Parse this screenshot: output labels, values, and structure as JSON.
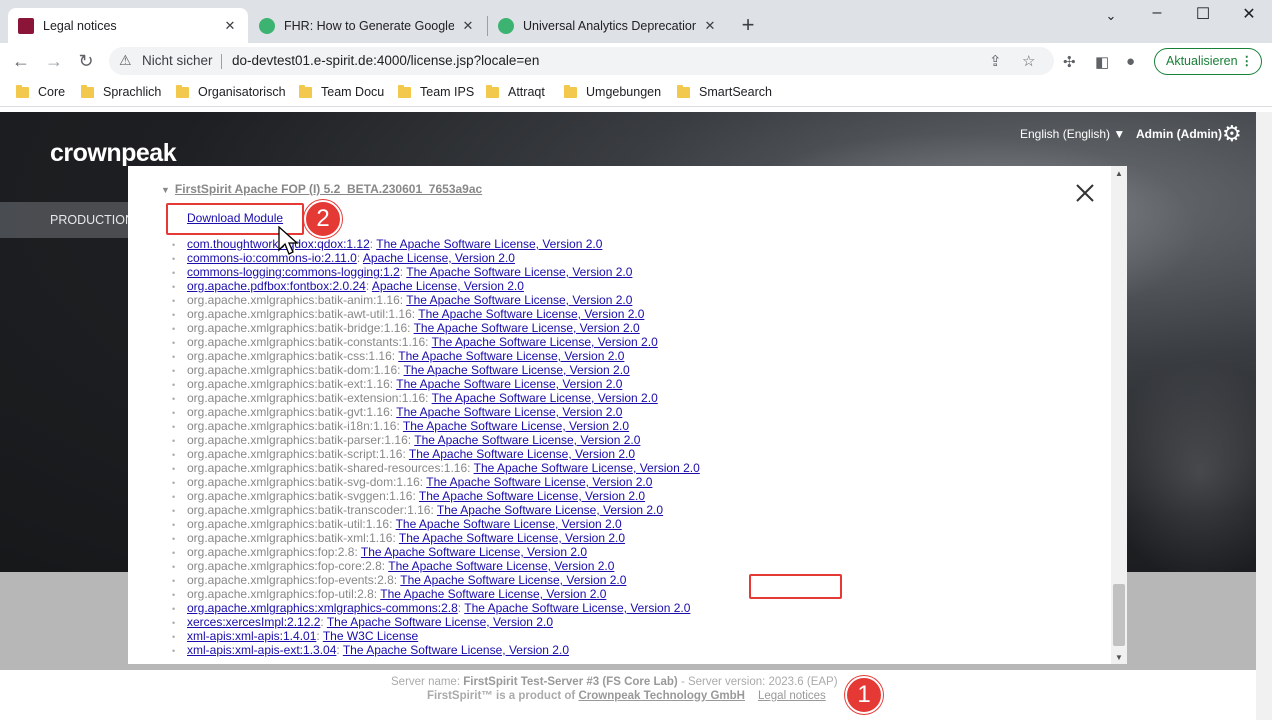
{
  "browser": {
    "tabs": [
      {
        "title": "Legal notices",
        "favicon_color": "#8b1538"
      },
      {
        "title": "FHR: How to Generate Google An",
        "favicon_color": "#3cb371"
      },
      {
        "title": "Universal Analytics Deprecation, l",
        "favicon_color": "#3cb371"
      }
    ],
    "new_tab": "+",
    "not_secure": "Nicht sicher",
    "url": "do-devtest01.e-spirit.de:4000/license.jsp?locale=en",
    "update_label": "Aktualisieren",
    "bookmarks": [
      "Core",
      "Sprachlich",
      "Organisatorisch",
      "Team Docu",
      "Team IPS",
      "Attraqt",
      "Umgebungen",
      "SmartSearch"
    ]
  },
  "header": {
    "logo": "crownpeak",
    "language": "English (English) ▼",
    "user": "Admin (Admin)",
    "nav_item": "PRODUCTION"
  },
  "modal": {
    "module_title": "FirstSpirit Apache FOP (I) 5.2_BETA.230601_7653a9ac",
    "download_label": "Download Module",
    "dependencies": [
      {
        "artifact": "com.thoughtworks.qdox:qdox:1.12",
        "license": "The Apache Software License, Version 2.0",
        "linked": true
      },
      {
        "artifact": "commons-io:commons-io:2.11.0",
        "license": "Apache License, Version 2.0",
        "linked": true
      },
      {
        "artifact": "commons-logging:commons-logging:1.2",
        "license": "The Apache Software License, Version 2.0",
        "linked": true
      },
      {
        "artifact": "org.apache.pdfbox:fontbox:2.0.24",
        "license": "Apache License, Version 2.0",
        "linked": true
      },
      {
        "artifact": "org.apache.xmlgraphics:batik-anim:1.16",
        "license": "The Apache Software License, Version 2.0",
        "linked": false
      },
      {
        "artifact": "org.apache.xmlgraphics:batik-awt-util:1.16",
        "license": "The Apache Software License, Version 2.0",
        "linked": false
      },
      {
        "artifact": "org.apache.xmlgraphics:batik-bridge:1.16",
        "license": "The Apache Software License, Version 2.0",
        "linked": false
      },
      {
        "artifact": "org.apache.xmlgraphics:batik-constants:1.16",
        "license": "The Apache Software License, Version 2.0",
        "linked": false
      },
      {
        "artifact": "org.apache.xmlgraphics:batik-css:1.16",
        "license": "The Apache Software License, Version 2.0",
        "linked": false
      },
      {
        "artifact": "org.apache.xmlgraphics:batik-dom:1.16",
        "license": "The Apache Software License, Version 2.0",
        "linked": false
      },
      {
        "artifact": "org.apache.xmlgraphics:batik-ext:1.16",
        "license": "The Apache Software License, Version 2.0",
        "linked": false
      },
      {
        "artifact": "org.apache.xmlgraphics:batik-extension:1.16",
        "license": "The Apache Software License, Version 2.0",
        "linked": false
      },
      {
        "artifact": "org.apache.xmlgraphics:batik-gvt:1.16",
        "license": "The Apache Software License, Version 2.0",
        "linked": false
      },
      {
        "artifact": "org.apache.xmlgraphics:batik-i18n:1.16",
        "license": "The Apache Software License, Version 2.0",
        "linked": false
      },
      {
        "artifact": "org.apache.xmlgraphics:batik-parser:1.16",
        "license": "The Apache Software License, Version 2.0",
        "linked": false
      },
      {
        "artifact": "org.apache.xmlgraphics:batik-script:1.16",
        "license": "The Apache Software License, Version 2.0",
        "linked": false
      },
      {
        "artifact": "org.apache.xmlgraphics:batik-shared-resources:1.16",
        "license": "The Apache Software License, Version 2.0",
        "linked": false
      },
      {
        "artifact": "org.apache.xmlgraphics:batik-svg-dom:1.16",
        "license": "The Apache Software License, Version 2.0",
        "linked": false
      },
      {
        "artifact": "org.apache.xmlgraphics:batik-svggen:1.16",
        "license": "The Apache Software License, Version 2.0",
        "linked": false
      },
      {
        "artifact": "org.apache.xmlgraphics:batik-transcoder:1.16",
        "license": "The Apache Software License, Version 2.0",
        "linked": false
      },
      {
        "artifact": "org.apache.xmlgraphics:batik-util:1.16",
        "license": "The Apache Software License, Version 2.0",
        "linked": false
      },
      {
        "artifact": "org.apache.xmlgraphics:batik-xml:1.16",
        "license": "The Apache Software License, Version 2.0",
        "linked": false
      },
      {
        "artifact": "org.apache.xmlgraphics:fop:2.8",
        "license": "The Apache Software License, Version 2.0",
        "linked": false
      },
      {
        "artifact": "org.apache.xmlgraphics:fop-core:2.8",
        "license": "The Apache Software License, Version 2.0",
        "linked": false
      },
      {
        "artifact": "org.apache.xmlgraphics:fop-events:2.8",
        "license": "The Apache Software License, Version 2.0",
        "linked": false
      },
      {
        "artifact": "org.apache.xmlgraphics:fop-util:2.8",
        "license": "The Apache Software License, Version 2.0",
        "linked": false
      },
      {
        "artifact": "org.apache.xmlgraphics:xmlgraphics-commons:2.8",
        "license": "The Apache Software License, Version 2.0",
        "linked": true
      },
      {
        "artifact": "xerces:xercesImpl:2.12.2",
        "license": "The Apache Software License, Version 2.0",
        "linked": true
      },
      {
        "artifact": "xml-apis:xml-apis:1.4.01",
        "license": "The W3C License",
        "linked": true
      },
      {
        "artifact": "xml-apis:xml-apis-ext:1.3.04",
        "license": "The Apache Software License, Version 2.0",
        "linked": true
      }
    ]
  },
  "footer": {
    "server_prefix": "Server name: ",
    "server_name": "FirstSpirit Test-Server #3 (FS Core Lab)",
    "version_text": " - Server version: 2023.6 (EAP)",
    "product_text": "FirstSpirit™ is a product of ",
    "company": "Crownpeak Technology GmbH",
    "legal_link": "Legal notices"
  },
  "annotations": {
    "badge_1": "1",
    "badge_2": "2",
    "color": "#e53935"
  }
}
